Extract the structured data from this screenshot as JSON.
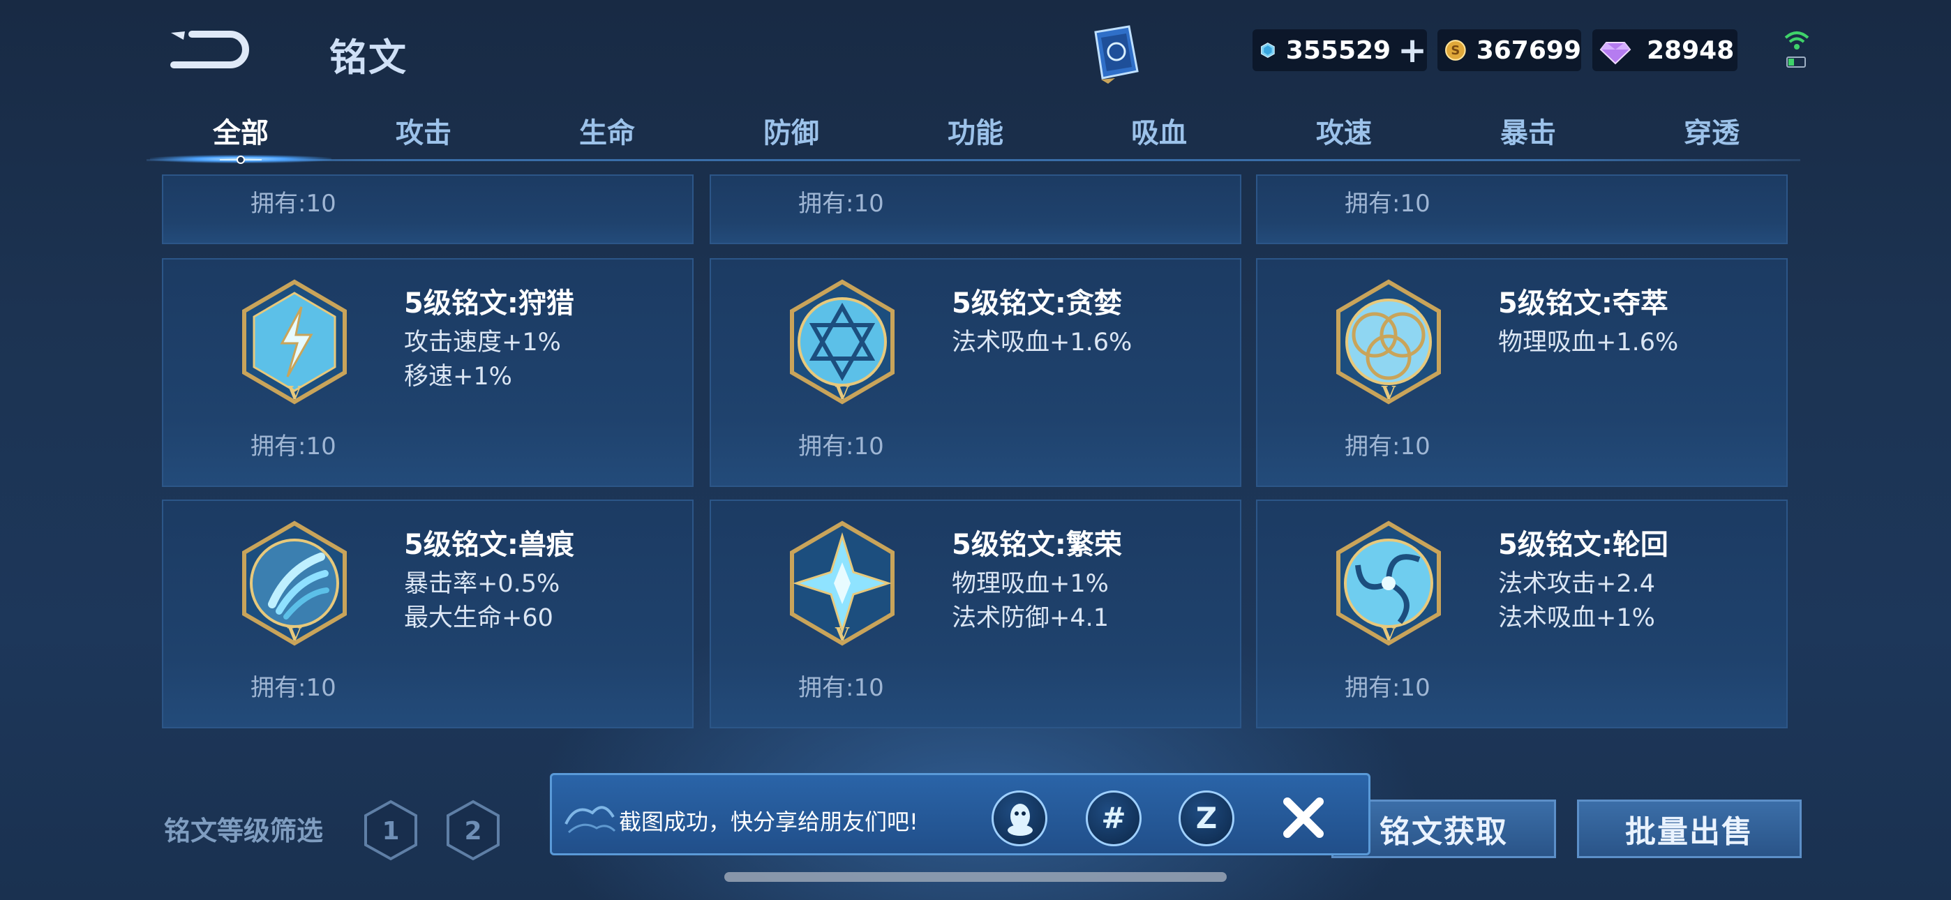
{
  "header": {
    "title": "铭文",
    "resources": [
      {
        "icon": "diamond-gem-icon",
        "value": "355529",
        "has_plus": true
      },
      {
        "icon": "gold-coin-icon",
        "value": "367699",
        "has_plus": false
      },
      {
        "icon": "purple-crystal-icon",
        "value": "28948",
        "has_plus": false
      }
    ]
  },
  "tabs": [
    {
      "label": "全部",
      "active": true
    },
    {
      "label": "攻击",
      "active": false
    },
    {
      "label": "生命",
      "active": false
    },
    {
      "label": "防御",
      "active": false
    },
    {
      "label": "功能",
      "active": false
    },
    {
      "label": "吸血",
      "active": false
    },
    {
      "label": "攻速",
      "active": false
    },
    {
      "label": "暴击",
      "active": false
    },
    {
      "label": "穿透",
      "active": false
    }
  ],
  "partial_row": [
    {
      "owned": "拥有:10"
    },
    {
      "owned": "拥有:10"
    },
    {
      "owned": "拥有:10"
    }
  ],
  "runes": [
    {
      "name": "5级铭文:狩猎",
      "attrs": [
        "攻击速度+1%",
        "移速+1%"
      ],
      "owned": "拥有:10",
      "icon": "lightning-rune-icon"
    },
    {
      "name": "5级铭文:贪婪",
      "attrs": [
        "法术吸血+1.6%"
      ],
      "owned": "拥有:10",
      "icon": "hexagram-rune-icon"
    },
    {
      "name": "5级铭文:夺萃",
      "attrs": [
        "物理吸血+1.6%"
      ],
      "owned": "拥有:10",
      "icon": "trinity-knot-rune-icon"
    },
    {
      "name": "5级铭文:兽痕",
      "attrs": [
        "暴击率+0.5%",
        "最大生命+60"
      ],
      "owned": "拥有:10",
      "icon": "claw-mark-rune-icon"
    },
    {
      "name": "5级铭文:繁荣",
      "attrs": [
        "物理吸血+1%",
        "法术防御+4.1"
      ],
      "owned": "拥有:10",
      "icon": "crystal-star-rune-icon"
    },
    {
      "name": "5级铭文:轮回",
      "attrs": [
        "法术攻击+2.4",
        "法术吸血+1%"
      ],
      "owned": "拥有:10",
      "icon": "swirl-rune-icon"
    }
  ],
  "rune_level_mark": "V",
  "footer": {
    "filter_label": "铭文等级筛选",
    "levels": [
      "1",
      "2"
    ],
    "get_button": "铭文获取",
    "sell_button": "批量出售"
  },
  "toast": {
    "message": "截图成功，快分享给朋友们吧!",
    "share_icons": [
      "qq-penguin-icon",
      "moments-icon",
      "qzone-icon"
    ],
    "close_icon": "close-icon"
  },
  "colors": {
    "accent": "#4ea4ff",
    "card_bg": "#1f426d",
    "card_border": "#2c5688",
    "gold": "#c9a45a"
  }
}
